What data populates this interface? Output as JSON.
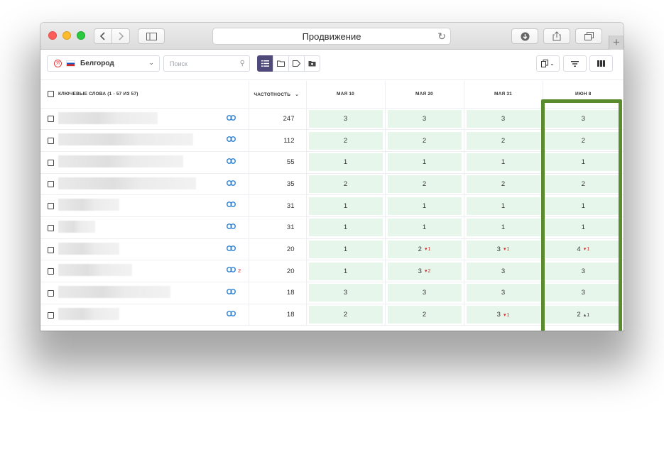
{
  "window": {
    "title": "Продвижение"
  },
  "toolbar": {
    "region_label": "Белгород",
    "search_placeholder": "Поиск"
  },
  "table": {
    "header": {
      "keywords": "КЛЮЧЕВЫЕ СЛОВА (1 - 57 ИЗ 57)",
      "frequency": "ЧАСТОТНОСТЬ",
      "dates": [
        "МАЯ 10",
        "МАЯ 20",
        "МАЯ 31",
        "ИЮН 8"
      ]
    },
    "rows": [
      {
        "freq": "247",
        "links": "",
        "pos": [
          {
            "v": "3",
            "c": "",
            "d": ""
          },
          {
            "v": "3",
            "c": "",
            "d": ""
          },
          {
            "v": "3",
            "c": "",
            "d": ""
          },
          {
            "v": "3",
            "c": "",
            "d": ""
          }
        ]
      },
      {
        "freq": "112",
        "links": "",
        "pos": [
          {
            "v": "2",
            "c": "",
            "d": ""
          },
          {
            "v": "2",
            "c": "",
            "d": ""
          },
          {
            "v": "2",
            "c": "",
            "d": ""
          },
          {
            "v": "2",
            "c": "",
            "d": ""
          }
        ]
      },
      {
        "freq": "55",
        "links": "",
        "pos": [
          {
            "v": "1",
            "c": "",
            "d": ""
          },
          {
            "v": "1",
            "c": "",
            "d": ""
          },
          {
            "v": "1",
            "c": "",
            "d": ""
          },
          {
            "v": "1",
            "c": "",
            "d": ""
          }
        ]
      },
      {
        "freq": "35",
        "links": "",
        "pos": [
          {
            "v": "2",
            "c": "",
            "d": ""
          },
          {
            "v": "2",
            "c": "",
            "d": ""
          },
          {
            "v": "2",
            "c": "",
            "d": ""
          },
          {
            "v": "2",
            "c": "",
            "d": ""
          }
        ]
      },
      {
        "freq": "31",
        "links": "",
        "pos": [
          {
            "v": "1",
            "c": "",
            "d": ""
          },
          {
            "v": "1",
            "c": "",
            "d": ""
          },
          {
            "v": "1",
            "c": "",
            "d": ""
          },
          {
            "v": "1",
            "c": "",
            "d": ""
          }
        ]
      },
      {
        "freq": "31",
        "links": "",
        "pos": [
          {
            "v": "1",
            "c": "",
            "d": ""
          },
          {
            "v": "1",
            "c": "",
            "d": ""
          },
          {
            "v": "1",
            "c": "",
            "d": ""
          },
          {
            "v": "1",
            "c": "",
            "d": ""
          }
        ]
      },
      {
        "freq": "20",
        "links": "",
        "pos": [
          {
            "v": "1",
            "c": "",
            "d": ""
          },
          {
            "v": "2",
            "c": "1",
            "d": "down"
          },
          {
            "v": "3",
            "c": "1",
            "d": "down"
          },
          {
            "v": "4",
            "c": "1",
            "d": "down"
          }
        ]
      },
      {
        "freq": "20",
        "links": "2",
        "pos": [
          {
            "v": "1",
            "c": "",
            "d": ""
          },
          {
            "v": "3",
            "c": "2",
            "d": "down"
          },
          {
            "v": "3",
            "c": "",
            "d": ""
          },
          {
            "v": "3",
            "c": "",
            "d": ""
          }
        ]
      },
      {
        "freq": "18",
        "links": "",
        "pos": [
          {
            "v": "3",
            "c": "",
            "d": ""
          },
          {
            "v": "3",
            "c": "",
            "d": ""
          },
          {
            "v": "3",
            "c": "",
            "d": ""
          },
          {
            "v": "3",
            "c": "",
            "d": ""
          }
        ]
      },
      {
        "freq": "18",
        "links": "",
        "pos": [
          {
            "v": "2",
            "c": "",
            "d": ""
          },
          {
            "v": "2",
            "c": "",
            "d": ""
          },
          {
            "v": "3",
            "c": "1",
            "d": "down"
          },
          {
            "v": "2",
            "c": "1",
            "d": "up"
          }
        ]
      }
    ]
  },
  "colors": {
    "cell_bg": "#e7f6ea",
    "highlight": "#5a8b2c",
    "link": "#2d7fd0",
    "down": "#d62828",
    "active_view": "#4f4a7a"
  },
  "icons": {
    "link": "link-icon",
    "down": "caret-down-icon",
    "up": "caret-up-icon"
  }
}
